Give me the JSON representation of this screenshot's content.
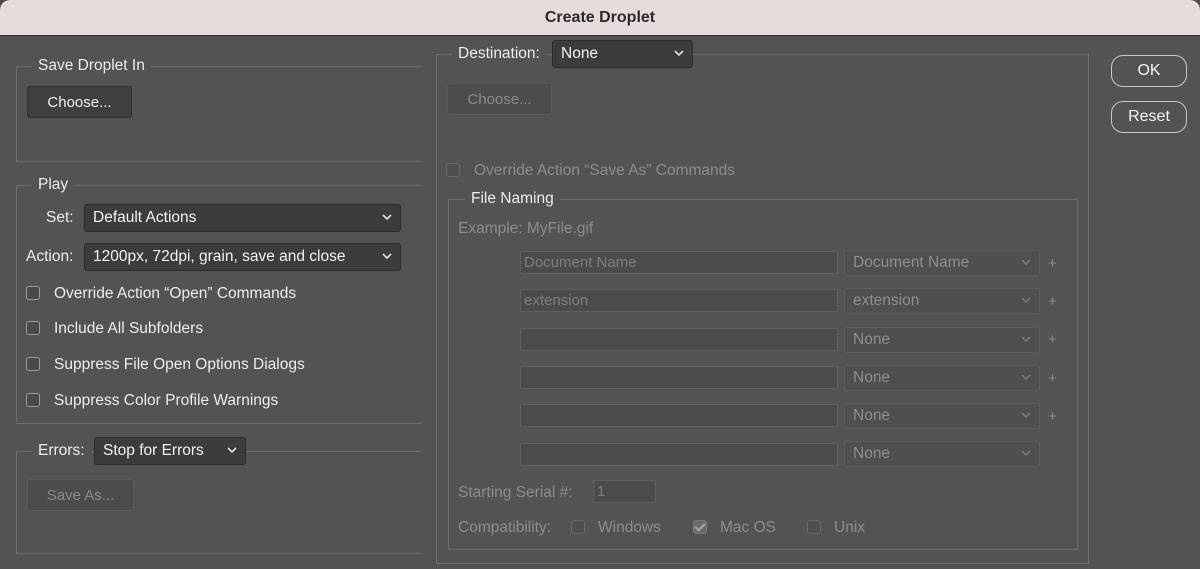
{
  "window": {
    "title": "Create Droplet"
  },
  "save_droplet": {
    "legend": "Save Droplet In",
    "choose_label": "Choose..."
  },
  "play": {
    "legend": "Play",
    "set_label": "Set:",
    "set_value": "Default Actions",
    "action_label": "Action:",
    "action_value": "1200px, 72dpi, grain, save and close",
    "options": [
      {
        "label": "Override Action “Open” Commands",
        "checked": false
      },
      {
        "label": "Include All Subfolders",
        "checked": false
      },
      {
        "label": "Suppress File Open Options Dialogs",
        "checked": false
      },
      {
        "label": "Suppress Color Profile Warnings",
        "checked": false
      }
    ]
  },
  "errors": {
    "label": "Errors:",
    "value": "Stop for Errors",
    "save_as_label": "Save As..."
  },
  "destination": {
    "label": "Destination:",
    "value": "None",
    "choose_label": "Choose...",
    "override_label": "Override Action “Save As” Commands"
  },
  "file_naming": {
    "legend": "File Naming",
    "example": "Example: MyFile.gif",
    "rows": [
      {
        "input": "Document Name",
        "select": "Document Name",
        "plus": "+"
      },
      {
        "input": "extension",
        "select": "extension",
        "plus": "+"
      },
      {
        "input": "",
        "select": "None",
        "plus": "+"
      },
      {
        "input": "",
        "select": "None",
        "plus": "+"
      },
      {
        "input": "",
        "select": "None",
        "plus": "+"
      },
      {
        "input": "",
        "select": "None",
        "plus": ""
      }
    ],
    "serial_label": "Starting Serial #:",
    "serial_value": "1",
    "compat_label": "Compatibility:",
    "compat": [
      {
        "label": "Windows",
        "checked": false
      },
      {
        "label": "Mac OS",
        "checked": true
      },
      {
        "label": "Unix",
        "checked": false
      }
    ]
  },
  "actions": {
    "ok_label": "OK",
    "reset_label": "Reset"
  },
  "icons": {
    "dropdown": "chevron-down-icon"
  }
}
